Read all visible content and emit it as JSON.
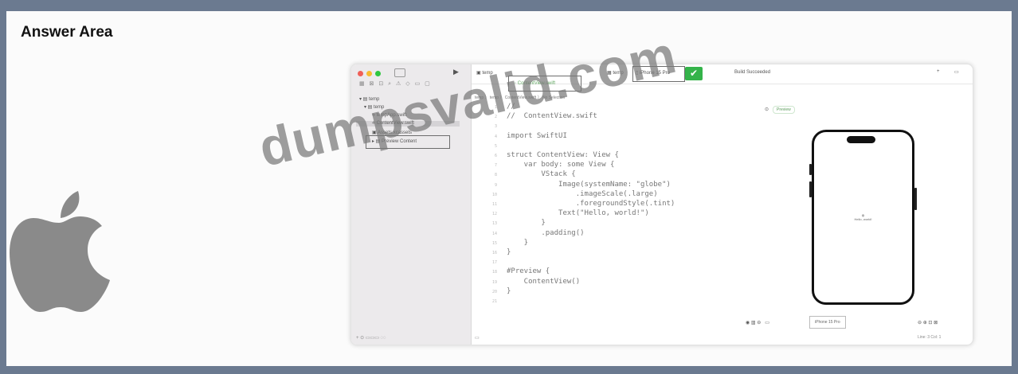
{
  "answer_area": {
    "title": "Answer Area"
  },
  "icons": {
    "apple": "apple-logo-icon",
    "check": "checkmark-icon",
    "play": "play-icon"
  },
  "colors": {
    "frame_border": "#6b7a90",
    "check_badge": "#34b34a",
    "watermark": "#787878"
  },
  "xcode": {
    "tab_project": "temp",
    "tab_scheme": "temp",
    "tab_destination": "iPhone 15 Pro",
    "status": "Build Succeeded",
    "jump_bar": "temp 〉 temp 〉 ContentView.swift 〉 No Selection",
    "navigator": [
      {
        "label": "temp"
      },
      {
        "label": "temp"
      },
      {
        "label": "tempApp.swift"
      },
      {
        "label": "ContentView.swift"
      },
      {
        "label": "Assets.xcassets"
      },
      {
        "label": "Preview Content"
      }
    ],
    "code_lines": [
      {
        "num": "1",
        "text": "//"
      },
      {
        "num": "2",
        "text": "//  ContentView.swift"
      },
      {
        "num": "3",
        "text": ""
      },
      {
        "num": "4",
        "text": "import SwiftUI"
      },
      {
        "num": "5",
        "text": ""
      },
      {
        "num": "6",
        "text": "struct ContentView: View {"
      },
      {
        "num": "7",
        "text": "    var body: some View {"
      },
      {
        "num": "8",
        "text": "        VStack {"
      },
      {
        "num": "9",
        "text": "            Image(systemName: \"globe\")"
      },
      {
        "num": "10",
        "text": "                .imageScale(.large)"
      },
      {
        "num": "11",
        "text": "                .foregroundStyle(.tint)"
      },
      {
        "num": "12",
        "text": "            Text(\"Hello, world!\")"
      },
      {
        "num": "13",
        "text": "        }"
      },
      {
        "num": "14",
        "text": "        .padding()"
      },
      {
        "num": "15",
        "text": "    }"
      },
      {
        "num": "16",
        "text": "}"
      },
      {
        "num": "17",
        "text": ""
      },
      {
        "num": "18",
        "text": "#Preview {"
      },
      {
        "num": "19",
        "text": "    ContentView()"
      },
      {
        "num": "20",
        "text": "}"
      },
      {
        "num": "21",
        "text": ""
      }
    ],
    "preview_chip": "Preview",
    "phone_text": "Hello, world!",
    "device_select": "iPhone 15 Pro",
    "bottom_position": "Line: 3 Col: 1"
  },
  "watermark": "dumpsvalid.com"
}
